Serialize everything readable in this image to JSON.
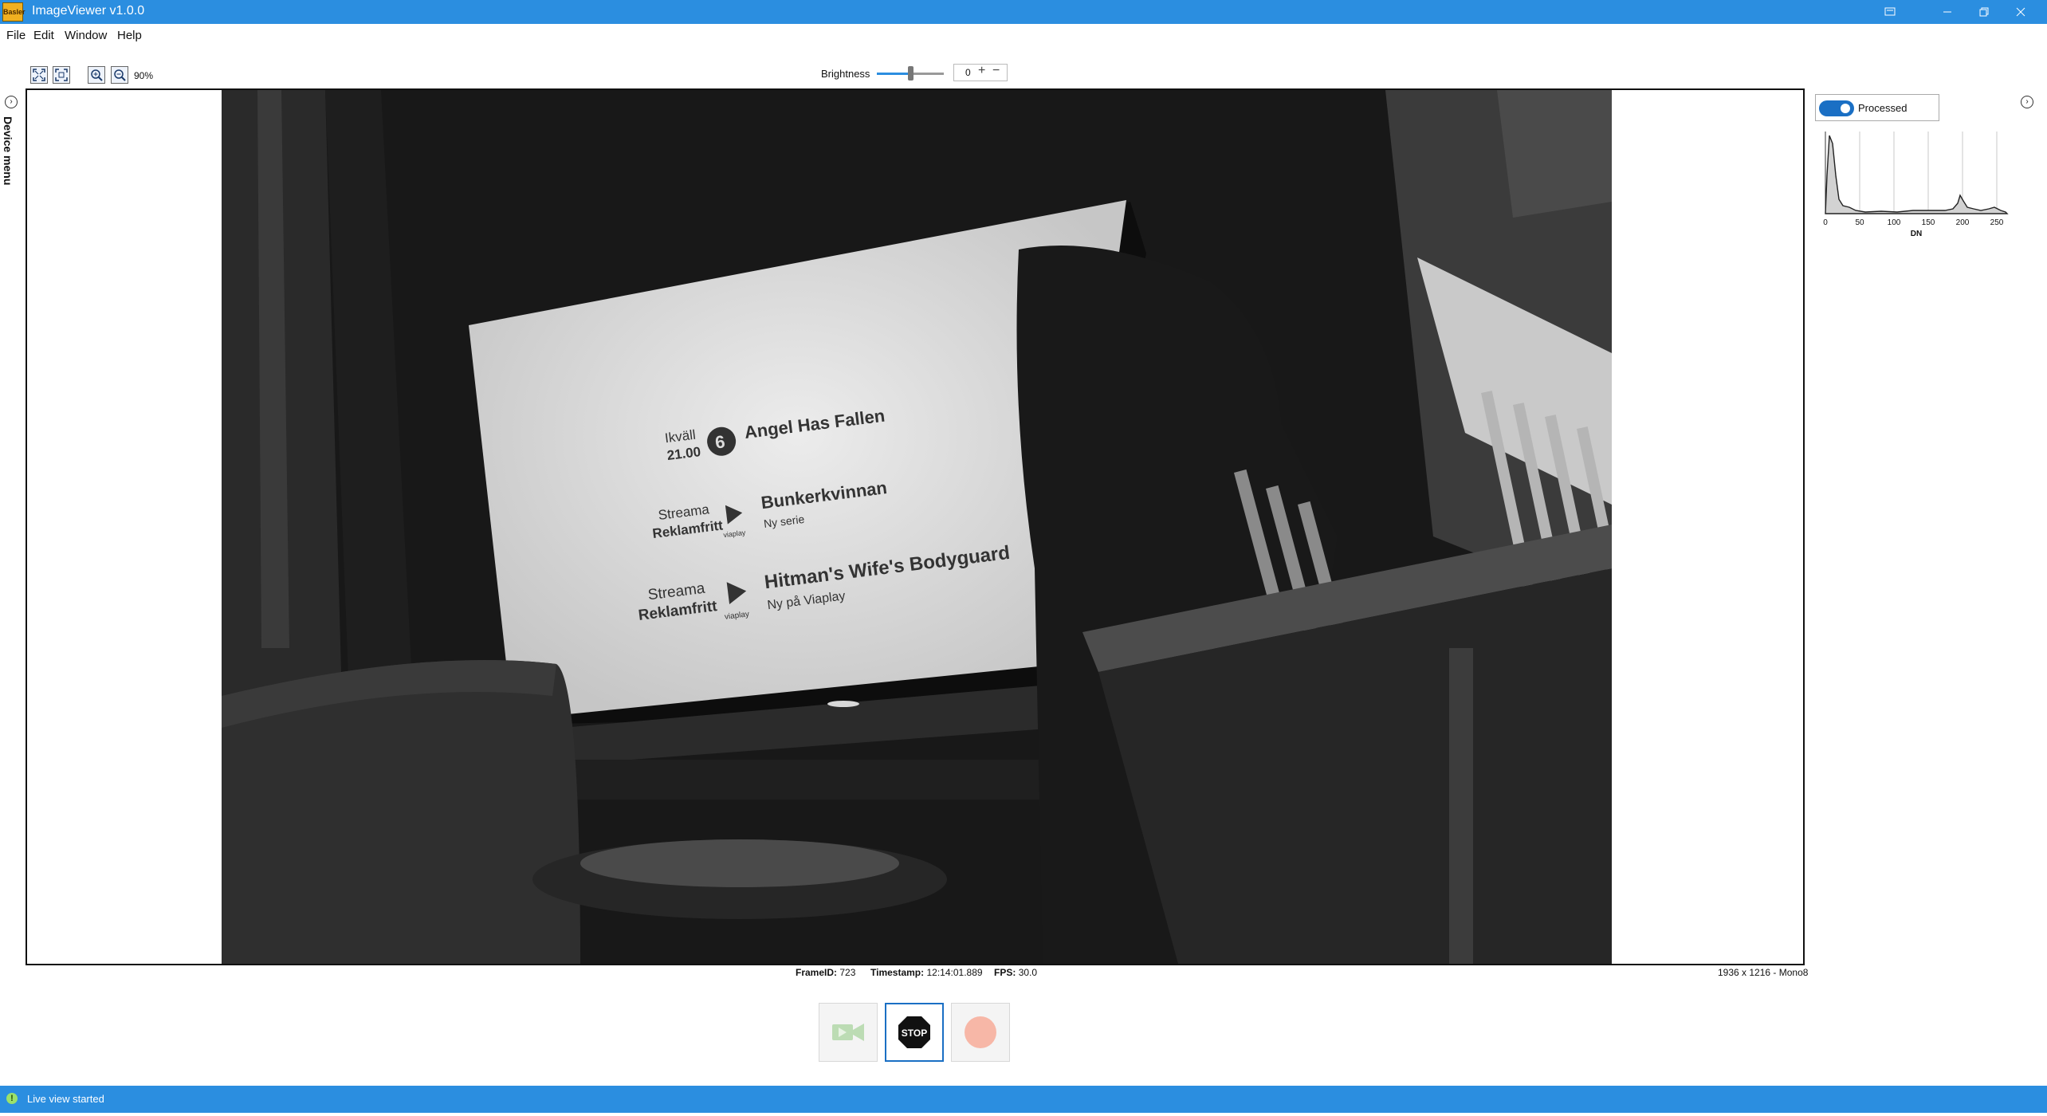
{
  "window": {
    "title": "ImageViewer v1.0.0",
    "logo_text": "Basler"
  },
  "menu": [
    {
      "label": "File"
    },
    {
      "label": "Edit"
    },
    {
      "label": "Window"
    },
    {
      "label": "Help"
    }
  ],
  "toolbar": {
    "zoom_level": "90%"
  },
  "brightness": {
    "label": "Brightness",
    "value": "0",
    "plus": "+",
    "minus": "−",
    "slider_fraction": 0.5
  },
  "side_panel": {
    "label": "Device menu"
  },
  "stats": {
    "frame_label": "FrameID:",
    "frame_value": "723",
    "timestamp_label": "Timestamp:",
    "timestamp_value": "12:14:01.889",
    "fps_label": "FPS:",
    "fps_value": "30.0",
    "resolution": "1936 x 1216 - Mono8"
  },
  "image": {
    "screen_rows": [
      {
        "left": "Ikväll",
        "left2": "21.00",
        "logo": "6",
        "title": "Angel Has Fallen",
        "subtitle": ""
      },
      {
        "left": "Streama",
        "left2": "Reklamfritt",
        "logo": "viaplay",
        "title": "Bunkerkvinnan",
        "subtitle": "Ny serie"
      },
      {
        "left": "Streama",
        "left2": "Reklamfritt",
        "logo": "viaplay",
        "title": "Hitman's Wife's Bodyguard",
        "subtitle": "Ny på Viaplay"
      }
    ]
  },
  "controls": {
    "stop_label": "STOP"
  },
  "histogram": {
    "toggle_label": "Processed",
    "toggle_on": true,
    "x_ticks": [
      "0",
      "50",
      "100",
      "150",
      "200",
      "250"
    ],
    "x_label": "DN"
  },
  "statusbar": {
    "text": "Live view started"
  },
  "colors": {
    "accent": "#2b8ee0",
    "active_border": "#1a6fc4"
  }
}
